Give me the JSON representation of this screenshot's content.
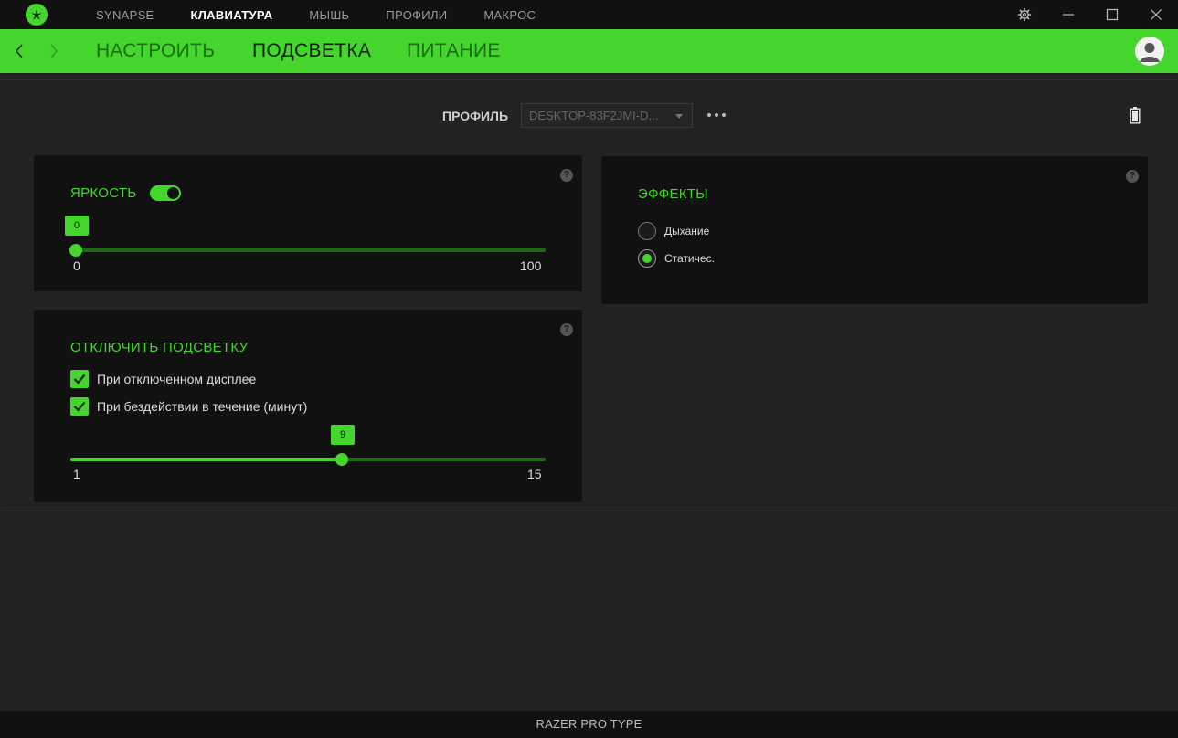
{
  "titlebar": {
    "tabs": [
      {
        "label": "SYNAPSE",
        "active": false
      },
      {
        "label": "КЛАВИАТУРА",
        "active": true
      },
      {
        "label": "МЫШЬ",
        "active": false
      },
      {
        "label": "ПРОФИЛИ",
        "active": false
      },
      {
        "label": "МАКРОС",
        "active": false
      }
    ],
    "icons": [
      "razer-logo-icon",
      "gear-icon",
      "minimize-icon",
      "maximize-icon",
      "close-icon"
    ]
  },
  "subnav": {
    "tabs": [
      {
        "label": "НАСТРОИТЬ",
        "active": false
      },
      {
        "label": "ПОДСВЕТКА",
        "active": true
      },
      {
        "label": "ПИТАНИЕ",
        "active": false
      }
    ]
  },
  "profile": {
    "label": "ПРОФИЛЬ",
    "selected": "DESKTOP-83F2JMI-D..."
  },
  "brightness": {
    "title": "ЯРКОСТЬ",
    "enabled": true,
    "value": "0",
    "min": "0",
    "max": "100"
  },
  "effects": {
    "title": "ЭФФЕКТЫ",
    "options": [
      {
        "label": "Дыхание",
        "selected": false
      },
      {
        "label": "Статичес.",
        "selected": true
      }
    ]
  },
  "lighting_off": {
    "title": "ОТКЛЮЧИТЬ ПОДСВЕТКУ",
    "options": [
      {
        "label": "При отключенном дисплее",
        "checked": true
      },
      {
        "label": "При бездействии в течение (минут)",
        "checked": true
      }
    ],
    "value": "9",
    "min": "1",
    "max": "15"
  },
  "help_label": "?",
  "footer": {
    "device": "RAZER PRO TYPE"
  },
  "colors": {
    "accent": "#44d62c",
    "background": "#222222",
    "panel": "#111111"
  }
}
